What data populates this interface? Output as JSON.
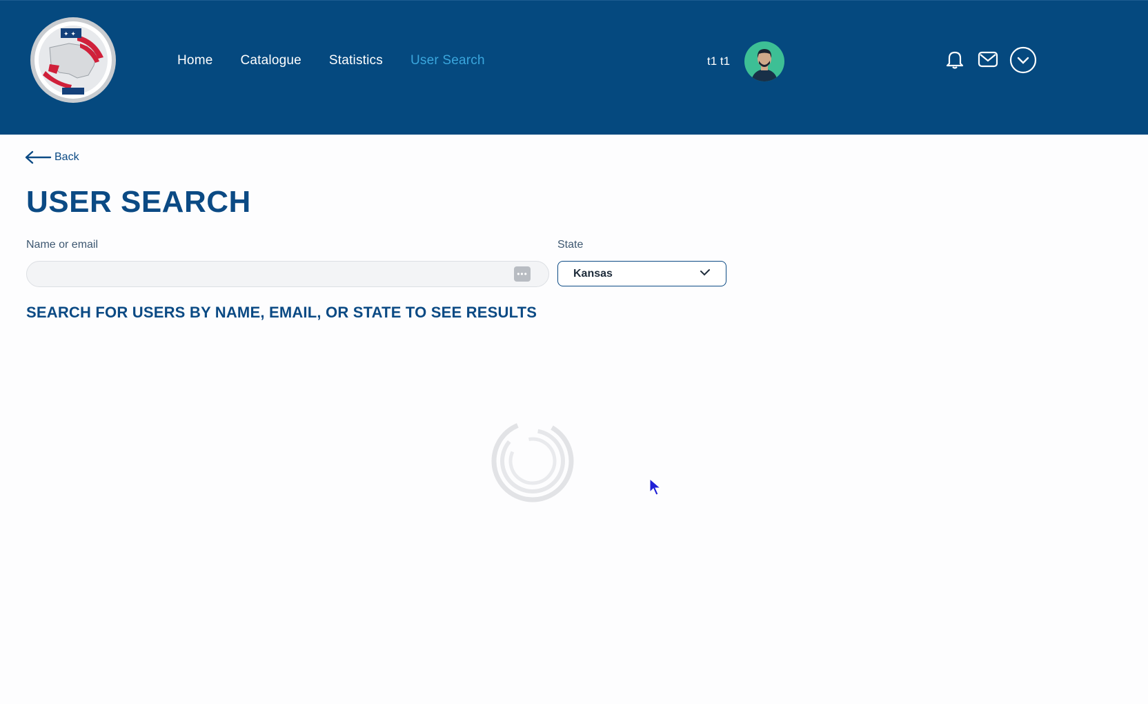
{
  "header": {
    "nav": [
      {
        "label": "Home",
        "active": false
      },
      {
        "label": "Catalogue",
        "active": false
      },
      {
        "label": "Statistics",
        "active": false
      },
      {
        "label": "User Search",
        "active": true
      }
    ],
    "user_name": "t1 t1",
    "icons": [
      "bell-icon",
      "mail-icon",
      "chevron-down-icon"
    ],
    "colors": {
      "background": "#05497f",
      "active_link": "#3aa6dd",
      "avatar": "#3dbf95"
    }
  },
  "back_label": "Back",
  "page_title": "USER SEARCH",
  "search": {
    "label": "Name or email",
    "value": "",
    "placeholder": ""
  },
  "state": {
    "label": "State",
    "selected": "Kansas"
  },
  "hint": "SEARCH FOR USERS BY NAME, EMAIL, OR STATE TO SEE RESULTS"
}
